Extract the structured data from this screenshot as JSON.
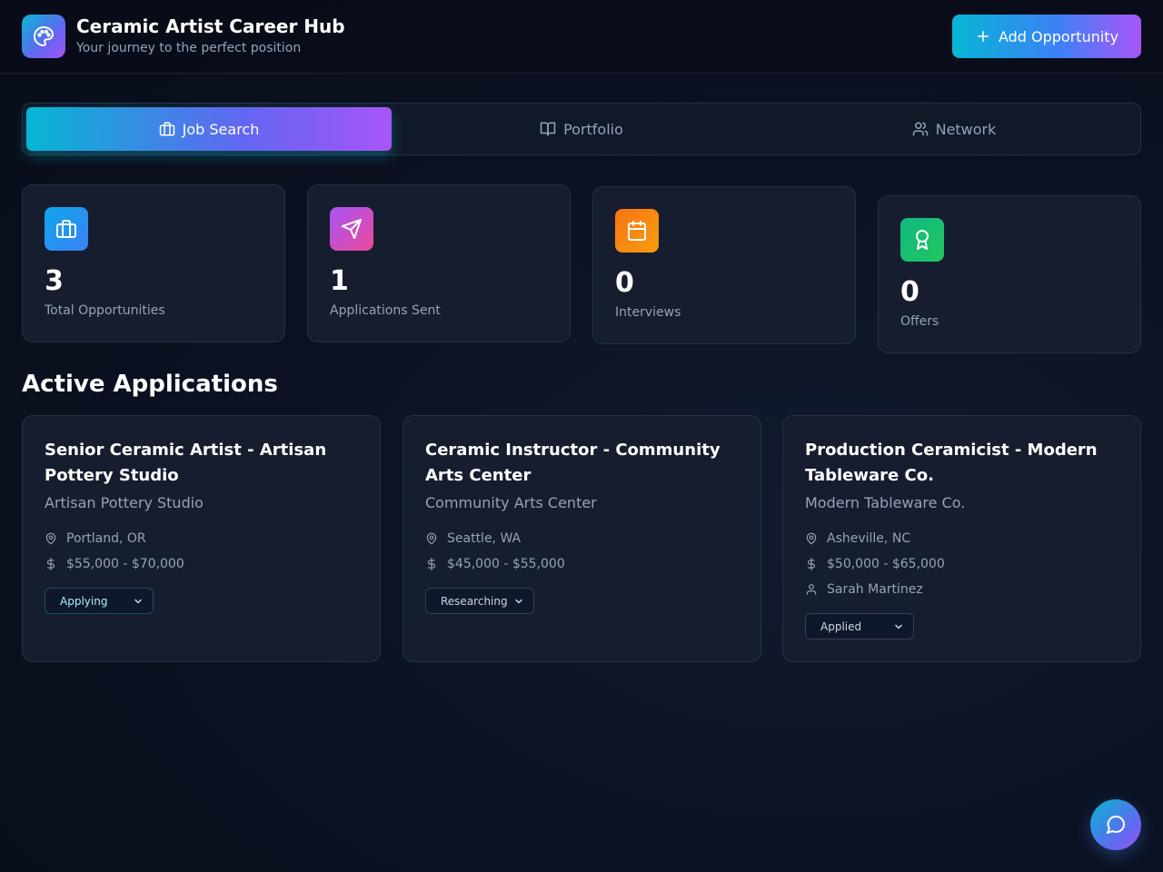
{
  "header": {
    "title": "Ceramic Artist Career Hub",
    "subtitle": "Your journey to the perfect position",
    "logo_icon": "palette-icon",
    "add_button_label": "Add Opportunity"
  },
  "tabs": [
    {
      "label": "Job Search",
      "icon": "briefcase-icon",
      "active": true
    },
    {
      "label": "Portfolio",
      "icon": "book-open-icon",
      "active": false
    },
    {
      "label": "Network",
      "icon": "users-icon",
      "active": false
    }
  ],
  "stats": [
    {
      "value": "3",
      "label": "Total Opportunities",
      "icon": "briefcase-icon",
      "color": "#0ea5e9"
    },
    {
      "value": "1",
      "label": "Applications Sent",
      "icon": "send-icon",
      "color": "#c026d3"
    },
    {
      "value": "0",
      "label": "Interviews",
      "icon": "calendar-icon",
      "color": "#f97316"
    },
    {
      "value": "0",
      "label": "Offers",
      "icon": "award-icon",
      "color": "#10b981"
    }
  ],
  "section_title": "Active Applications",
  "jobs": [
    {
      "title": "Senior Ceramic Artist - Artisan Pottery Studio",
      "company": "Artisan Pottery Studio",
      "location": "Portland, OR",
      "salary": "$55,000 - $70,000",
      "status": "Applying"
    },
    {
      "title": "Ceramic Instructor - Community Arts Center",
      "company": "Community Arts Center",
      "location": "Seattle, WA",
      "salary": "$45,000 - $55,000",
      "status": "Researching"
    },
    {
      "title": "Production Ceramicist - Modern Tableware Co.",
      "company": "Modern Tableware Co.",
      "location": "Asheville, NC",
      "salary": "$50,000 - $65,000",
      "contact": "Sarah Martinez",
      "status": "Applied"
    }
  ],
  "chat_button_icon": "message-circle-icon"
}
